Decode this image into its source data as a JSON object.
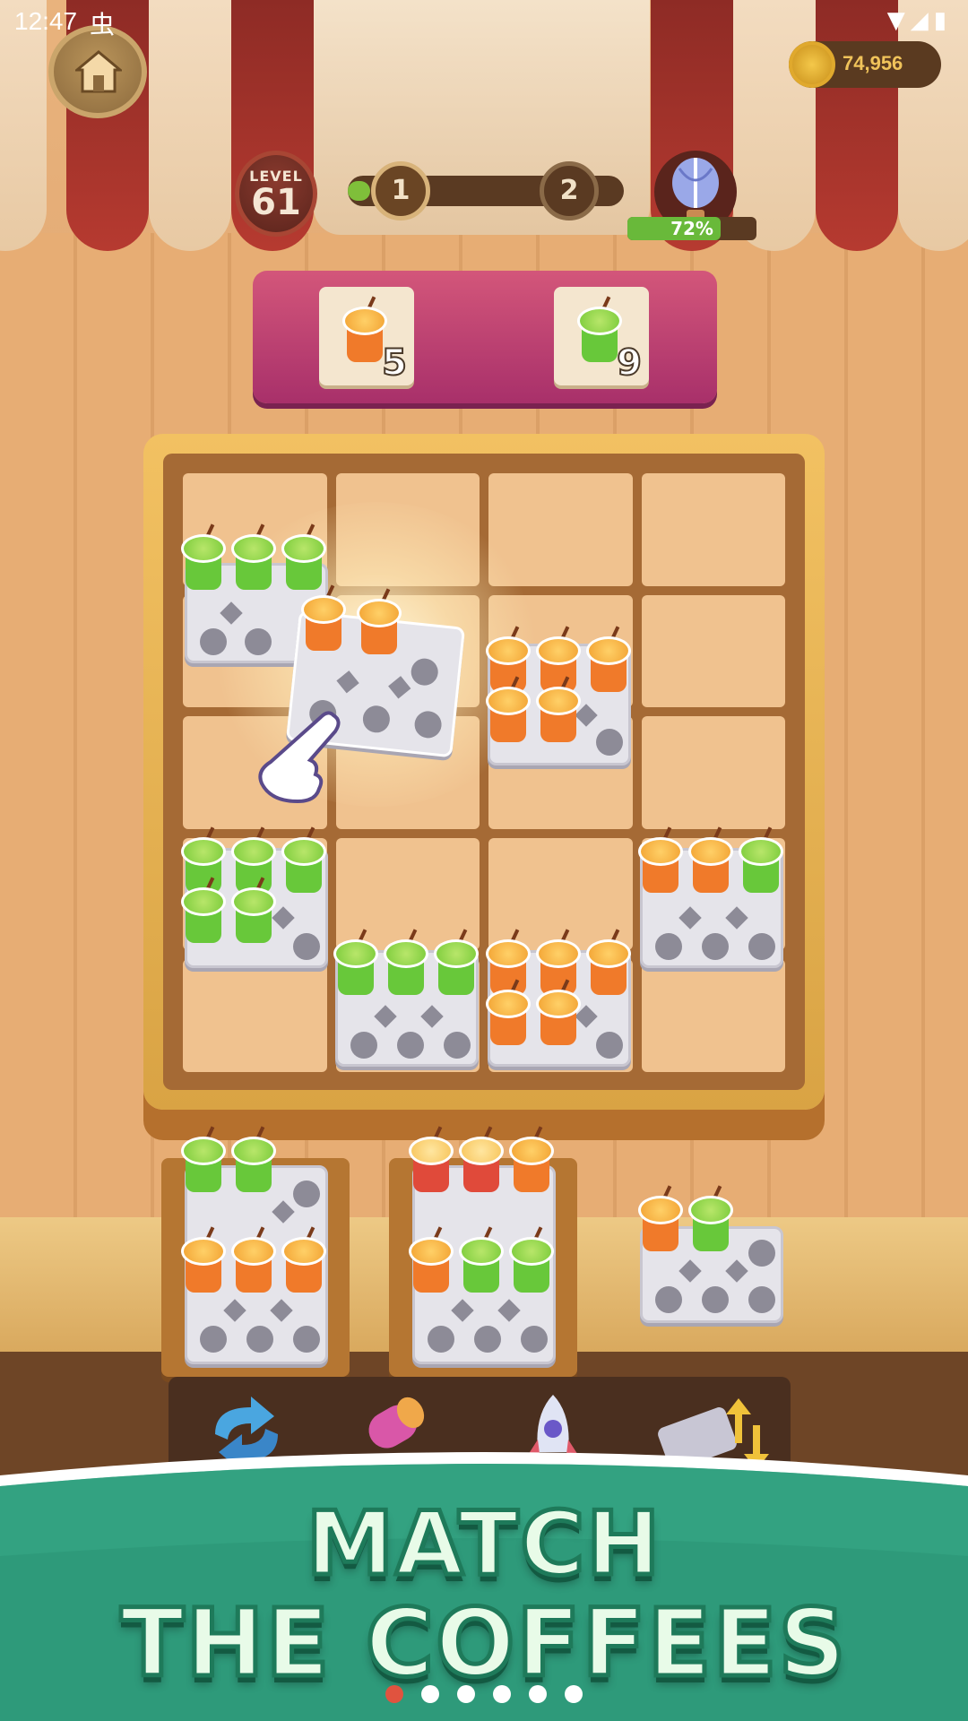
{
  "status_bar": {
    "time": "12:47",
    "notification_icon": "bug-icon",
    "system_icons": [
      "wifi-icon",
      "signal-icon",
      "battery-icon"
    ]
  },
  "hud": {
    "home_icon": "house-icon",
    "coins": "74,956",
    "level_label": "LEVEL",
    "level_number": "61",
    "stage_progress": {
      "from": "1",
      "to": "2",
      "fill_fraction": 0.08
    },
    "reward_icon": "hot-air-balloon-icon",
    "reward_percent_text": "72%",
    "reward_percent": 0.72
  },
  "orders": [
    {
      "drink": "orange-juice",
      "count": "5"
    },
    {
      "drink": "mojito",
      "count": "9"
    }
  ],
  "boosters": [
    "shuffle-icon",
    "magnet-icon",
    "rocket-icon",
    "tray-swap-icon"
  ],
  "banner": {
    "line1": "MATCH",
    "line2": "THE COFFEES",
    "pages": 6,
    "active_page": 1
  },
  "colors": {
    "accent_red": "#e0533f",
    "banner_teal": "#2e9a7a",
    "progress_green": "#69b93a"
  }
}
